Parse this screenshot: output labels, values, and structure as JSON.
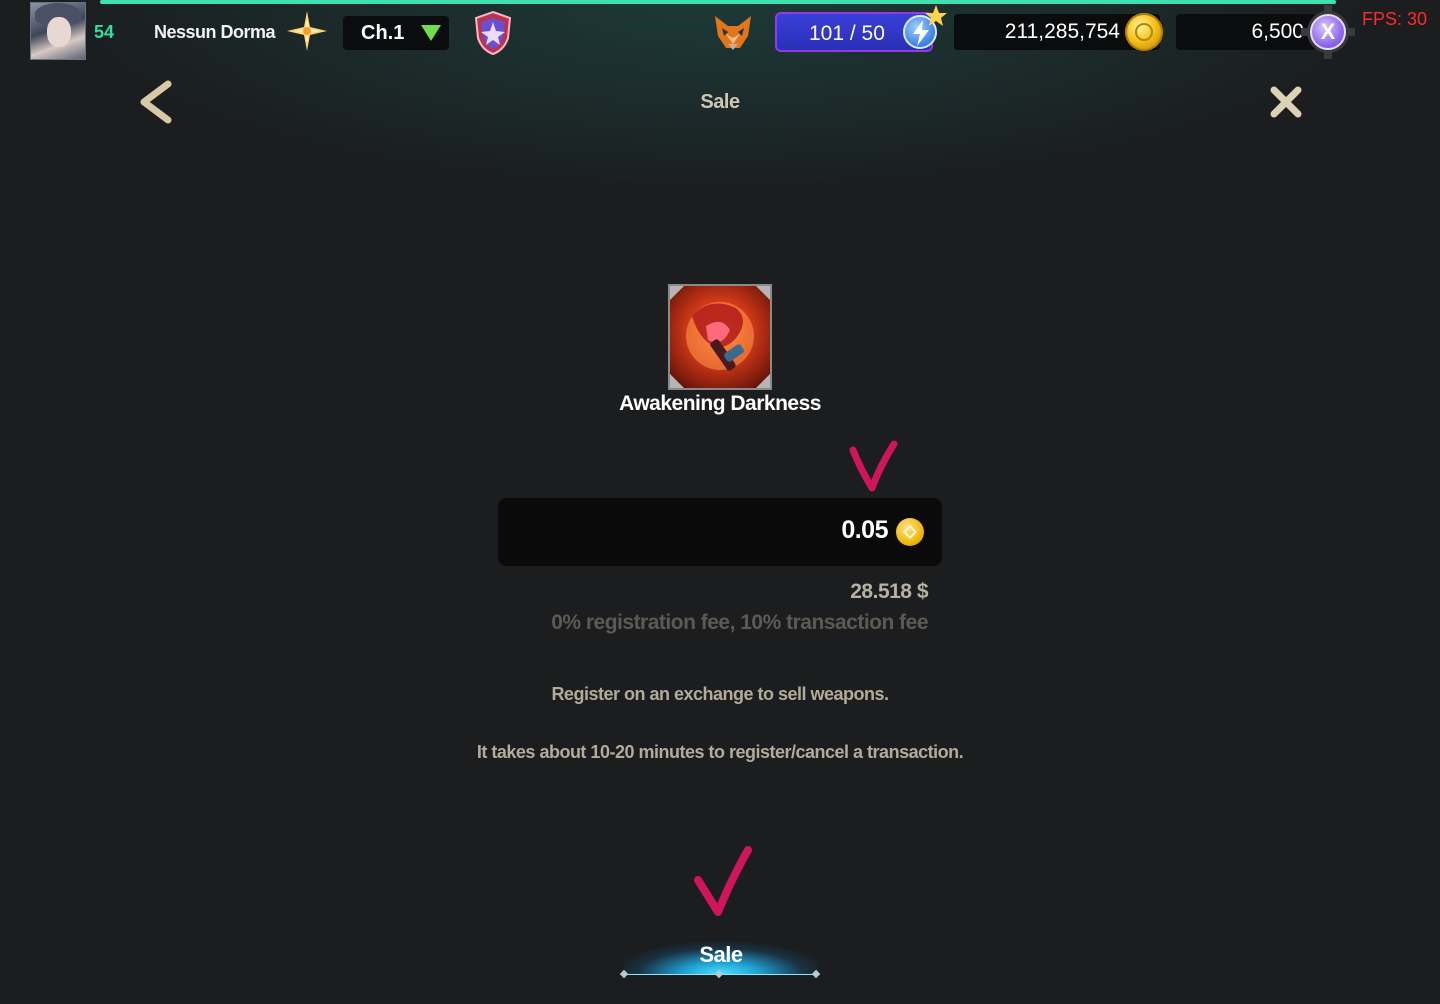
{
  "player": {
    "level": "54",
    "name": "Nessun Dorma",
    "chapter": "Ch.1"
  },
  "resources": {
    "energy": "101 / 50",
    "gold": "211,285,754",
    "tokens": "6,500"
  },
  "debug": {
    "fps": "FPS: 30"
  },
  "header": {
    "title": "Sale"
  },
  "item": {
    "name": "Awakening Darkness"
  },
  "price": {
    "value": "0.05",
    "usd": "28.518 $",
    "fees": "0% registration fee,  10% transaction fee"
  },
  "notices": [
    "Register on an exchange to sell weapons.",
    "It takes about 10-20 minutes to register/cancel a transaction."
  ],
  "actions": {
    "sale_label": "Sale"
  },
  "colors": {
    "accent_teal": "#3fe0b0",
    "level_green": "#2fe0a0",
    "energy_blue": "#3a3fd8",
    "check_mark_magenta": "#d0155c",
    "fps_red": "#ff2a2a"
  },
  "icons": [
    "avatar",
    "star-icon",
    "chevron-down-icon",
    "shield-icon",
    "fox-icon",
    "bolt-icon",
    "gold-coin-icon",
    "x-token-icon",
    "gear-icon",
    "back-arrow-icon",
    "close-icon",
    "bnb-coin-icon",
    "check-mark-icon"
  ]
}
